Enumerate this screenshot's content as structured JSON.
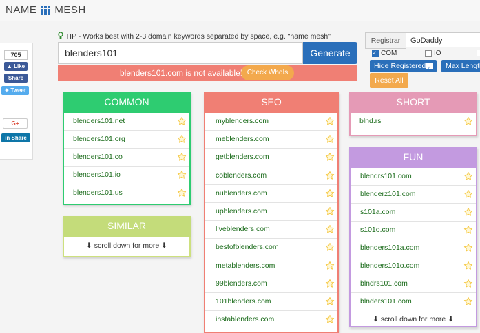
{
  "brand": {
    "part1": "NAME",
    "part2": "MESH"
  },
  "social": {
    "like_count": "705",
    "fb_like": "Like",
    "fb_share": "Share",
    "tweet": "Tweet",
    "gplus": "G+",
    "linkedin_icon": "in",
    "linkedin_share": "Share"
  },
  "tip": "TIP - Works best with 2-3 domain keywords separated by space, e.g. \"name mesh\"",
  "search": {
    "value": "blenders101",
    "button": "Generate"
  },
  "alert": {
    "message": "blenders101.com is not available!",
    "whois": "Check WhoIs"
  },
  "registrar": {
    "label": "Registrar",
    "selected": "GoDaddy"
  },
  "tld_filters": [
    {
      "label": "COM",
      "checked": true
    },
    {
      "label": "IO",
      "checked": false
    }
  ],
  "hide_registered": "Hide Registered",
  "max_length": "Max Length",
  "reset": "Reset All",
  "panels": {
    "common": {
      "title": "COMMON",
      "items": [
        "blenders101.net",
        "blenders101.org",
        "blenders101.co",
        "blenders101.io",
        "blenders101.us"
      ]
    },
    "similar": {
      "title": "SIMILAR",
      "more": "⬇ scroll down for more ⬇"
    },
    "seo": {
      "title": "SEO",
      "items": [
        "myblenders.com",
        "meblenders.com",
        "getblenders.com",
        "coblenders.com",
        "nublenders.com",
        "upblenders.com",
        "liveblenders.com",
        "bestofblenders.com",
        "metablenders.com",
        "99blenders.com",
        "101blenders.com",
        "instablenders.com"
      ]
    },
    "short": {
      "title": "SHORT",
      "items": [
        "blnd.rs"
      ]
    },
    "fun": {
      "title": "FUN",
      "items": [
        "blendrs101.com",
        "blenderz101.com",
        "s101a.com",
        "s101o.com",
        "blenders101a.com",
        "blenders101o.com",
        "blndrs101.com",
        "blnders101.com"
      ],
      "more": "⬇ scroll down for more ⬇"
    }
  },
  "colors": {
    "primary": "#2a6fba",
    "common": "#2ecc71",
    "similar": "#c4dc7a",
    "seo": "#f07f74",
    "short": "#e59ab6",
    "fun": "#c39ae0",
    "accent": "#f3a94d",
    "star": "#f5c842"
  },
  "icons": {
    "star": "star-icon",
    "tip": "lightbulb-icon",
    "logo": "grid-icon"
  }
}
